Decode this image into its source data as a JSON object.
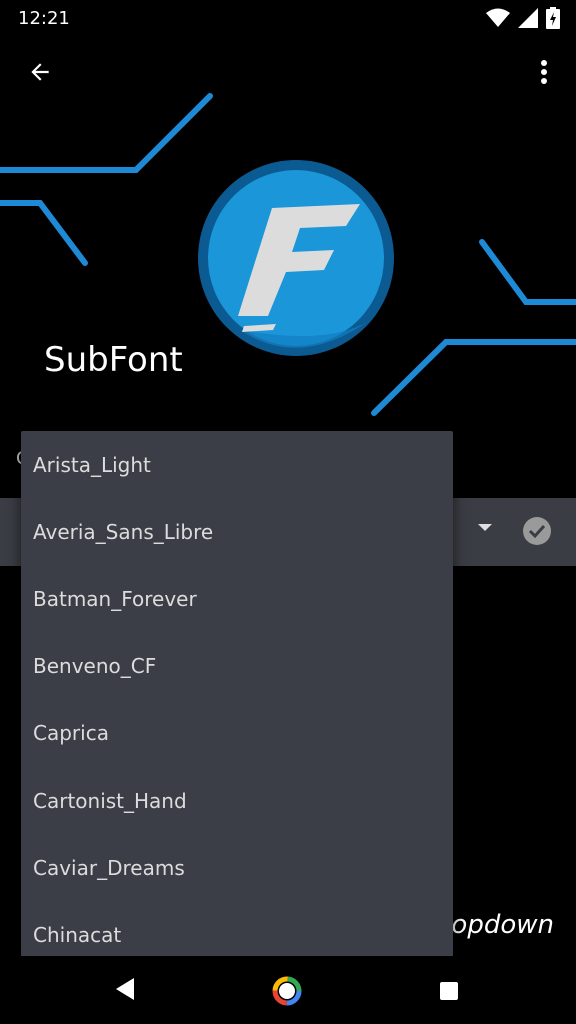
{
  "status_bar": {
    "time": "12:21",
    "icons": [
      "wifi-icon",
      "signal-icon",
      "battery-charging-icon"
    ]
  },
  "toolbar": {
    "back_icon": "arrow-back-icon",
    "menu_icon": "more-vert-icon"
  },
  "header": {
    "app_title": "SubFont",
    "logo_letter": "F",
    "accent_color": "#1e8ad6"
  },
  "background": {
    "partial_label": "C",
    "hint_text": "ropdown"
  },
  "dropdown": {
    "items": [
      "Arista_Light",
      "Averia_Sans_Libre",
      "Batman_Forever",
      "Benveno_CF",
      "Caprica",
      "Cartonist_Hand",
      "Caviar_Dreams",
      "Chinacat"
    ]
  },
  "nav_bar": {
    "icons": [
      "nav-back-icon",
      "nav-home-icon",
      "nav-recents-icon"
    ]
  }
}
